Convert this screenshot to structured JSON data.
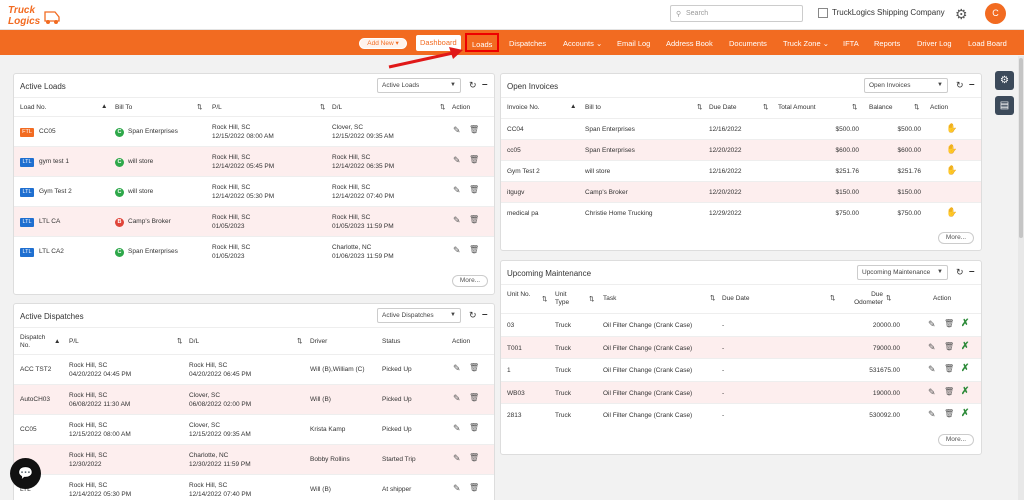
{
  "header": {
    "logo_text": "Truck Logics",
    "search_placeholder": "Search",
    "company": "TruckLogics Shipping Company",
    "avatar_initial": "C"
  },
  "nav": {
    "add_new": "Add New",
    "items": [
      "Dashboard",
      "Loads",
      "Dispatches",
      "Accounts",
      "Email Log",
      "Address Book",
      "Documents",
      "Truck Zone",
      "IFTA",
      "Reports",
      "Driver Log",
      "Load Board"
    ]
  },
  "active_loads": {
    "title": "Active Loads",
    "select": "Active Loads",
    "columns": [
      "Load No.",
      "Bill To",
      "P/L",
      "D/L",
      "Action"
    ],
    "rows": [
      {
        "type": "FTL",
        "load": "CC05",
        "bill_badge": "C",
        "bill": "Span Enterprises",
        "pl": "Rock Hill, SC",
        "pl_date": "12/15/2022 08:00 AM",
        "dl": "Clover, SC",
        "dl_date": "12/15/2022 09:35 AM"
      },
      {
        "type": "LTL",
        "load": "gym test 1",
        "bill_badge": "C",
        "bill": "will store",
        "pl": "Rock Hill, SC",
        "pl_date": "12/14/2022 05:45 PM",
        "dl": "Rock Hill, SC",
        "dl_date": "12/14/2022 06:35 PM"
      },
      {
        "type": "LTL",
        "load": "Gym Test 2",
        "bill_badge": "C",
        "bill": "will store",
        "pl": "Rock Hill, SC",
        "pl_date": "12/14/2022 05:30 PM",
        "dl": "Rock Hill, SC",
        "dl_date": "12/14/2022 07:40 PM"
      },
      {
        "type": "LTL",
        "load": "LTL CA",
        "bill_badge": "B",
        "bill": "Camp's Broker",
        "pl": "Rock Hill, SC",
        "pl_date": "01/05/2023",
        "dl": "Rock Hill, SC",
        "dl_date": "01/05/2023 11:59 PM"
      },
      {
        "type": "LTL",
        "load": "LTL CA2",
        "bill_badge": "C",
        "bill": "Span Enterprises",
        "pl": "Rock Hill, SC",
        "pl_date": "01/05/2023",
        "dl": "Charlotte, NC",
        "dl_date": "01/06/2023 11:59 PM"
      }
    ],
    "more": "More..."
  },
  "open_invoices": {
    "title": "Open Invoices",
    "select": "Open Invoices",
    "columns": [
      "Invoice No.",
      "Bill to",
      "Due Date",
      "Total Amount",
      "Balance",
      "Action"
    ],
    "rows": [
      {
        "inv": "CC04",
        "bill": "Span Enterprises",
        "due": "12/16/2022",
        "total": "$500.00",
        "balance": "$500.00",
        "action": true
      },
      {
        "inv": "cc05",
        "bill": "Span Enterprises",
        "due": "12/20/2022",
        "total": "$600.00",
        "balance": "$600.00",
        "action": true
      },
      {
        "inv": "Gym Test 2",
        "bill": "will store",
        "due": "12/16/2022",
        "total": "$251.76",
        "balance": "$251.76",
        "action": true
      },
      {
        "inv": "itgugv",
        "bill": "Camp's Broker",
        "due": "12/20/2022",
        "total": "$150.00",
        "balance": "$150.00",
        "action": false
      },
      {
        "inv": "medical pa",
        "bill": "Christie Home Trucking",
        "due": "12/29/2022",
        "total": "$750.00",
        "balance": "$750.00",
        "action": true
      }
    ],
    "more": "More..."
  },
  "active_dispatches": {
    "title": "Active Dispatches",
    "select": "Active Dispatches",
    "columns": [
      "Dispatch No.",
      "P/L",
      "D/L",
      "Driver",
      "Status",
      "Action"
    ],
    "rows": [
      {
        "no": "ACC TST2",
        "pl": "Rock Hill, SC",
        "pl_date": "04/20/2022 04:45 PM",
        "dl": "Rock Hill, SC",
        "dl_date": "04/20/2022 06:45 PM",
        "driver": "Will (B),William (C)",
        "status": "Picked Up"
      },
      {
        "no": "AutoCH03",
        "pl": "Rock Hill, SC",
        "pl_date": "06/08/2022 11:30 AM",
        "dl": "Clover, SC",
        "dl_date": "06/08/2022 02:00 PM",
        "driver": "Will (B)",
        "status": "Picked Up"
      },
      {
        "no": "CC05",
        "pl": "Rock Hill, SC",
        "pl_date": "12/15/2022 08:00 AM",
        "dl": "Clover, SC",
        "dl_date": "12/15/2022 09:35 AM",
        "driver": "Krista Kamp",
        "status": "Picked Up"
      },
      {
        "no": "",
        "pl": "Rock Hill, SC",
        "pl_date": "12/30/2022",
        "dl": "Charlotte, NC",
        "dl_date": "12/30/2022 11:59 PM",
        "driver": "Bobby Rollins",
        "status": "Started Trip"
      },
      {
        "no": "LTL",
        "pl": "Rock Hill, SC",
        "pl_date": "12/14/2022 05:30 PM",
        "dl": "Rock Hill, SC",
        "dl_date": "12/14/2022 07:40 PM",
        "driver": "Will (B)",
        "status": "At shipper"
      }
    ]
  },
  "upcoming_maintenance": {
    "title": "Upcoming Maintenance",
    "select": "Upcoming Maintenance",
    "columns": [
      "Unit No.",
      "Unit Type",
      "Task",
      "Due Date",
      "Due Odometer",
      "Action"
    ],
    "rows": [
      {
        "unit": "03",
        "type": "Truck",
        "task": "Oil Filter Change (Crank Case)",
        "due": "-",
        "odo": "20000.00"
      },
      {
        "unit": "T001",
        "type": "Truck",
        "task": "Oil Filter Change (Crank Case)",
        "due": "-",
        "odo": "79000.00"
      },
      {
        "unit": "1",
        "type": "Truck",
        "task": "Oil Filter Change (Crank Case)",
        "due": "-",
        "odo": "531675.00"
      },
      {
        "unit": "WB03",
        "type": "Truck",
        "task": "Oil Filter Change (Crank Case)",
        "due": "-",
        "odo": "19000.00"
      },
      {
        "unit": "2813",
        "type": "Truck",
        "task": "Oil Filter Change (Crank Case)",
        "due": "-",
        "odo": "530092.00"
      }
    ],
    "more": "More..."
  }
}
